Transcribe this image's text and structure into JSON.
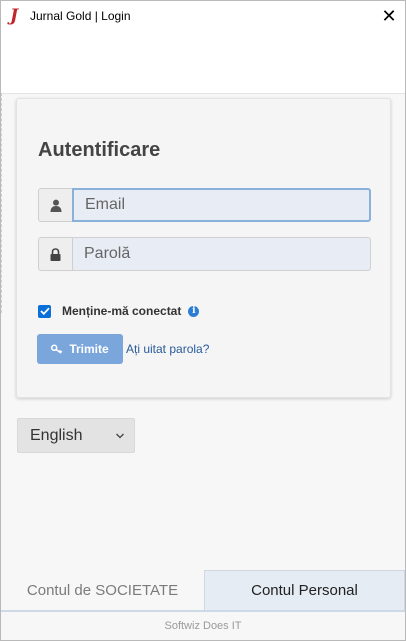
{
  "window": {
    "title": "Jurnal Gold | Login",
    "app_icon_glyph": "J",
    "close_glyph": "✕"
  },
  "login": {
    "heading": "Autentificare",
    "email_placeholder": "Email",
    "password_placeholder": "Parolă",
    "remember_label": "Menține-mă conectat",
    "remember_checked": true,
    "submit_label": "Trimite",
    "forgot_link": "Ați uitat parola?"
  },
  "language": {
    "selected": "English"
  },
  "tabs": [
    {
      "label": "Contul de SOCIETATE",
      "active": false
    },
    {
      "label": "Contul Personal",
      "active": true
    }
  ],
  "footer": {
    "text": "Softwiz Does IT"
  },
  "icons": {
    "app": "jurnal-logo-icon",
    "close": "close-icon",
    "user": "user-icon",
    "lock": "lock-icon",
    "check": "checkmark-icon",
    "info": "info-icon",
    "key": "key-icon",
    "chevron": "chevron-down-icon"
  },
  "colors": {
    "accent": "#0a6fd8",
    "submit_button": "#7ba6dc",
    "link": "#2a5b9a",
    "logo": "#c0272d"
  }
}
